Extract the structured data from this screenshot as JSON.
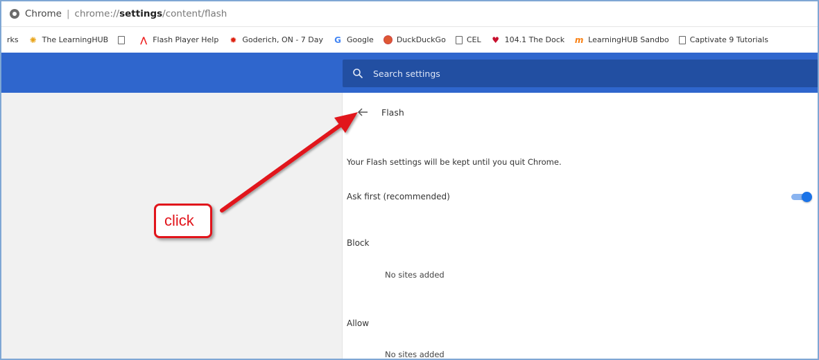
{
  "omnibox": {
    "app_name": "Chrome",
    "url_scheme": "chrome://",
    "url_host": "settings",
    "url_path": "/content/flash"
  },
  "bookmarks": [
    {
      "label": "rks",
      "icon": "none"
    },
    {
      "label": "The LearningHUB",
      "icon": "sun-icon"
    },
    {
      "label": "",
      "icon": "page-icon"
    },
    {
      "label": "Flash Player Help",
      "icon": "adobe-icon"
    },
    {
      "label": "Goderich, ON - 7 Day",
      "icon": "maple-leaf-icon"
    },
    {
      "label": "Google",
      "icon": "google-icon"
    },
    {
      "label": "DuckDuckGo",
      "icon": "duckduckgo-icon"
    },
    {
      "label": "CEL",
      "icon": "page-icon"
    },
    {
      "label": "104.1 The Dock",
      "icon": "radio-icon"
    },
    {
      "label": "LearningHUB Sandbo",
      "icon": "moodle-icon"
    },
    {
      "label": "Captivate 9 Tutorials",
      "icon": "page-icon"
    }
  ],
  "search": {
    "placeholder": "Search settings"
  },
  "page": {
    "title": "Flash",
    "note": "Your Flash settings will be kept until you quit Chrome.",
    "ask_first_label": "Ask first (recommended)",
    "ask_first_enabled": true,
    "block_label": "Block",
    "block_empty": "No sites added",
    "allow_label": "Allow",
    "allow_empty": "No sites added"
  },
  "annotation": {
    "callout_text": "click",
    "color": "#e1141b"
  },
  "colors": {
    "header_blue": "#2f66cd",
    "search_blue": "#224fa2",
    "toggle_blue": "#1a73e8"
  }
}
